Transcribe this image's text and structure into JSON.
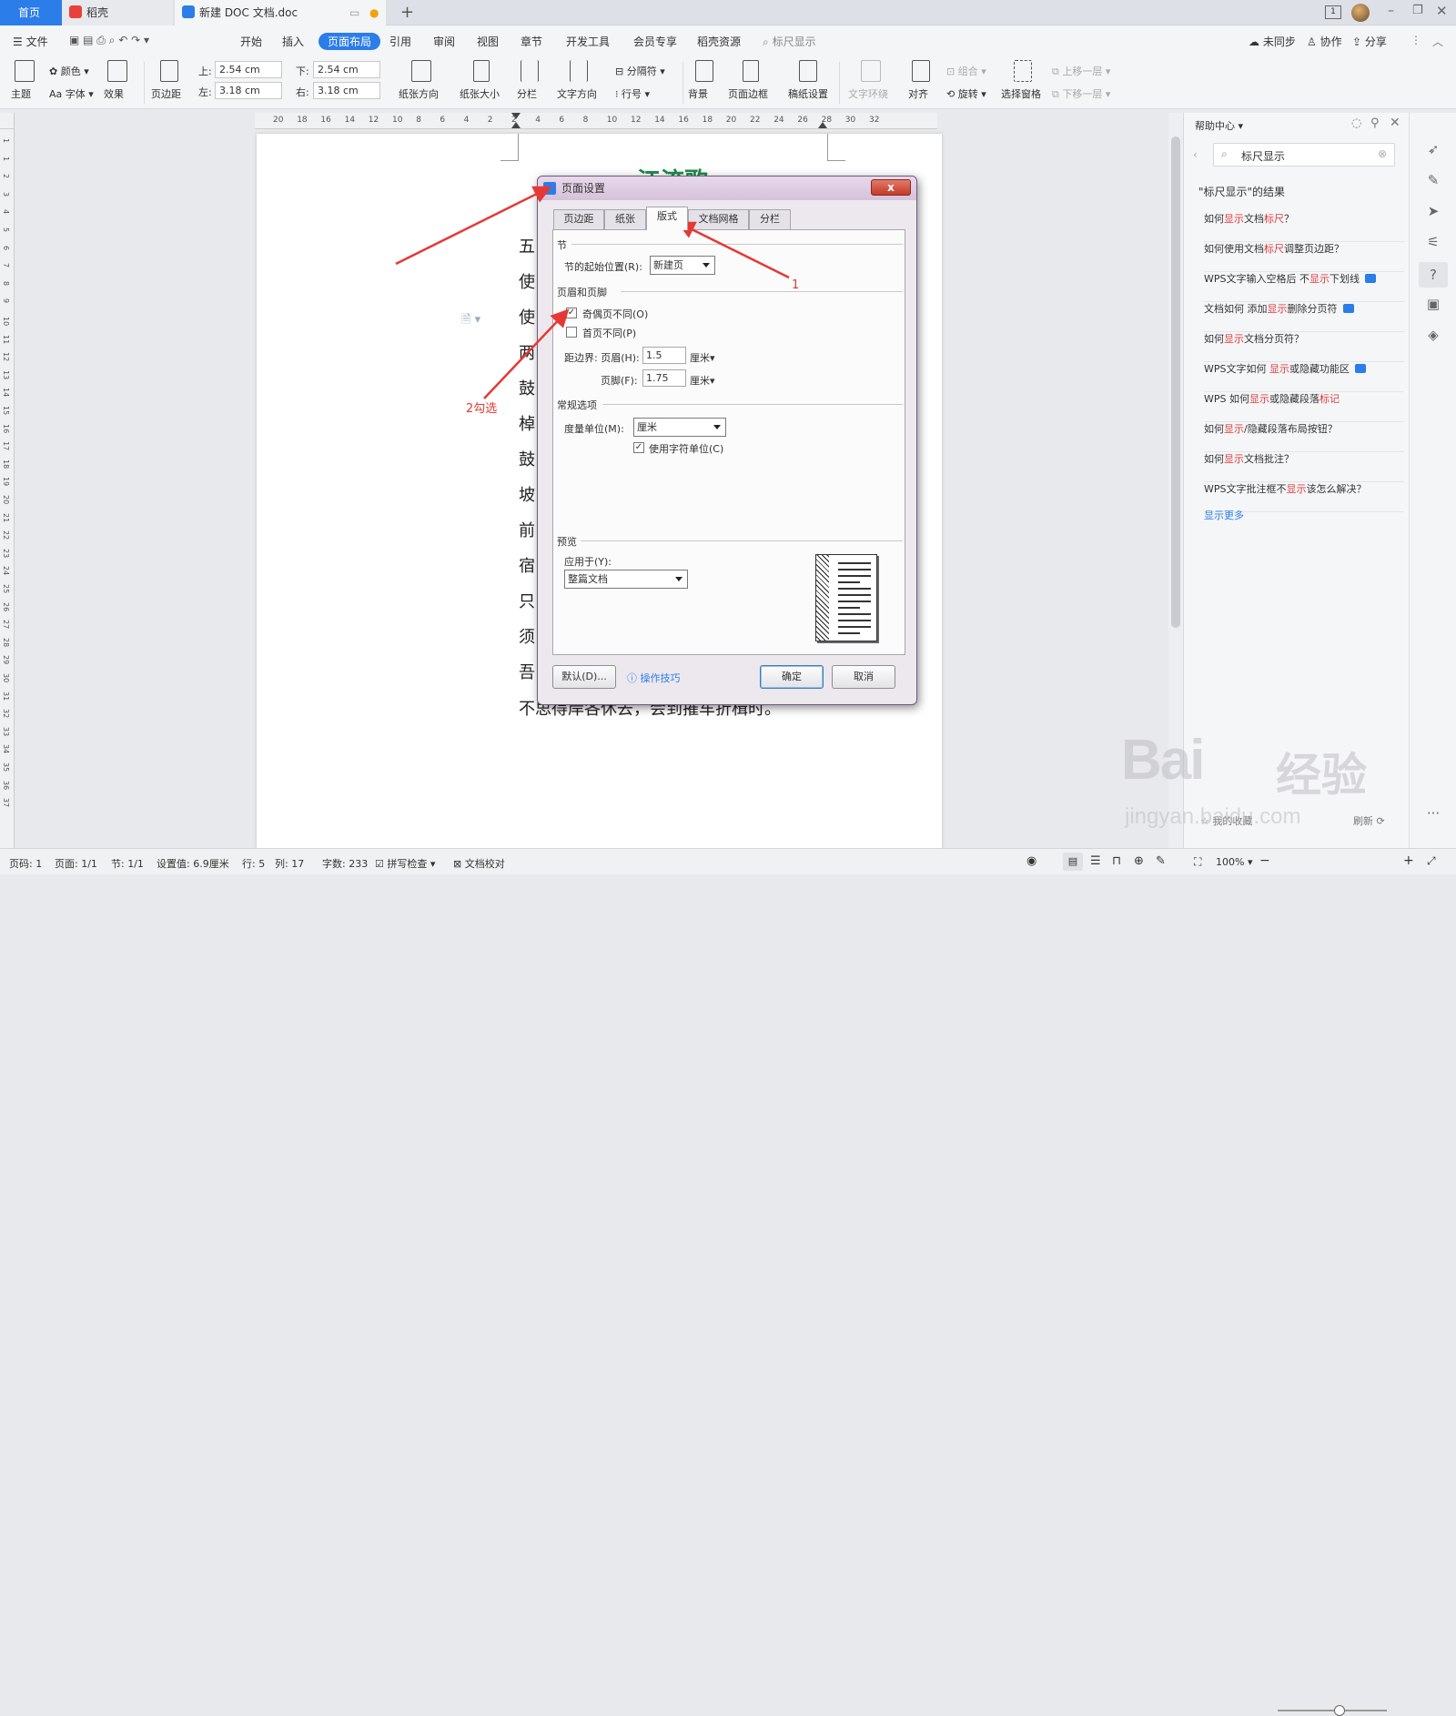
{
  "tabs": [
    {
      "label": "首页",
      "active": true
    },
    {
      "label": "稻壳"
    },
    {
      "label": "新建 DOC 文档.doc"
    }
  ],
  "menu": {
    "file": "文件",
    "items": [
      "开始",
      "插入",
      "页面布局",
      "引用",
      "审阅",
      "视图",
      "章节",
      "开发工具",
      "会员专享",
      "稻壳资源"
    ],
    "active_item": "页面布局",
    "search": "标尺显示",
    "sync": "未同步",
    "collab": "协作",
    "share": "分享"
  },
  "ribbon": {
    "theme": "主题",
    "color": "颜色",
    "font": "字体",
    "effect": "效果",
    "margins": "页边距",
    "top_label": "上:",
    "top_value": "2.54 cm",
    "bottom_label": "下:",
    "bottom_value": "2.54 cm",
    "left_label": "左:",
    "left_value": "3.18 cm",
    "right_label": "右:",
    "right_value": "3.18 cm",
    "orientation": "纸张方向",
    "size": "纸张大小",
    "columns": "分栏",
    "text_dir": "文字方向",
    "breaks": "分隔符",
    "line_num": "行号",
    "background": "背景",
    "border": "页面边框",
    "manuscript": "稿纸设置",
    "wrap": "文字环绕",
    "align": "对齐",
    "group": "组合",
    "rotate": "旋转",
    "select_pane": "选择窗格",
    "bring_fwd": "上移一层",
    "send_back": "下移一层"
  },
  "ruler": {
    "h_ticks": [
      "20",
      "18",
      "16",
      "14",
      "12",
      "10",
      "8",
      "6",
      "4",
      "2",
      "2",
      "4",
      "6",
      "8",
      "10",
      "12",
      "14",
      "16",
      "18",
      "20",
      "22",
      "24",
      "26",
      "28",
      "30",
      "32"
    ],
    "v_ticks": [
      "1",
      "1",
      "2",
      "3",
      "4",
      "5",
      "6",
      "7",
      "8",
      "9",
      "10",
      "11",
      "12",
      "13",
      "14",
      "15",
      "16",
      "17",
      "18",
      "19",
      "20",
      "21",
      "22",
      "23",
      "24",
      "25",
      "26",
      "27",
      "28",
      "29",
      "30",
      "31",
      "32",
      "33",
      "34",
      "35",
      "36",
      "37"
    ]
  },
  "document": {
    "title": "江流歌",
    "line_starts": [
      "五",
      "使",
      "使",
      "两",
      "鼓",
      "棹",
      "鼓",
      "坡",
      "前",
      "宿",
      "只",
      "须",
      "吾"
    ],
    "last_line": "不思得岸各休去，会到摧车折楫时。"
  },
  "dialog": {
    "title": "页面设置",
    "close": "x",
    "tabs": [
      "页边距",
      "纸张",
      "版式",
      "文档网格",
      "分栏"
    ],
    "active_tab": "版式",
    "section_group": "节",
    "section_start_label": "节的起始位置(R):",
    "section_start_value": "新建页",
    "hf_group": "页眉和页脚",
    "odd_even": "奇偶页不同(O)",
    "odd_even_checked": true,
    "first_page": "首页不同(P)",
    "first_page_checked": false,
    "distance_label": "距边界: 页眉(H):",
    "header_value": "1.5",
    "footer_label": "页脚(F):",
    "footer_value": "1.75",
    "unit": "厘米",
    "general_group": "常规选项",
    "measure_label": "度量单位(M):",
    "measure_value": "厘米",
    "char_unit": "使用字符单位(C)",
    "char_unit_checked": true,
    "preview_group": "预览",
    "apply_label": "应用于(Y):",
    "apply_value": "整篇文档",
    "default_btn": "默认(D)...",
    "tips": "操作技巧",
    "ok": "确定",
    "cancel": "取消"
  },
  "annotations": {
    "a1": "1",
    "a2": "2勾选"
  },
  "help": {
    "title": "帮助中心",
    "search_value": "标尺显示",
    "results_title": "\"标尺显示\"的结果",
    "items": [
      {
        "pre": "如何",
        "hl": "显示",
        "post": "文档",
        "hl2": "标尺",
        "post2": "？",
        "video": false
      },
      {
        "pre": "如何使用文档",
        "hl": "标尺",
        "post": "调整页边距？",
        "hl2": "",
        "post2": "",
        "video": false
      },
      {
        "pre": "WPS文字输入空格后 不",
        "hl": "显示",
        "post": "下划线",
        "hl2": "",
        "post2": "",
        "video": true
      },
      {
        "pre": "文档如何 添加",
        "hl": "显示",
        "post": "删除分页符",
        "hl2": "",
        "post2": "",
        "video": true
      },
      {
        "pre": "如何",
        "hl": "显示",
        "post": "文档分页符？",
        "hl2": "",
        "post2": "",
        "video": false
      },
      {
        "pre": "WPS文字如何 ",
        "hl": "显示",
        "post": "或隐藏功能区",
        "hl2": "",
        "post2": "",
        "video": true
      },
      {
        "pre": "WPS 如何",
        "hl": "显示",
        "post": "或隐藏段落",
        "hl2": "标记",
        "post2": "",
        "video": false
      },
      {
        "pre": "如何",
        "hl": "显示",
        "post": "/隐藏段落布局按钮？",
        "hl2": "",
        "post2": "",
        "video": false
      },
      {
        "pre": "如何",
        "hl": "显示",
        "post": "文档批注？",
        "hl2": "",
        "post2": "",
        "video": false
      },
      {
        "pre": "WPS文字批注框不",
        "hl": "显示",
        "post": "该怎么解决？",
        "hl2": "",
        "post2": "",
        "video": false
      }
    ],
    "more": "显示更多",
    "favorites": "我的收藏",
    "refresh": "刷新"
  },
  "status": {
    "page_num": "页码: 1",
    "pages": "页面: 1/1",
    "section": "节: 1/1",
    "setting": "设置值: 6.9厘米",
    "row": "行: 5",
    "col": "列: 17",
    "words": "字数: 233",
    "spell": "拼写检查",
    "proof": "文档校对",
    "zoom": "100%"
  },
  "watermark": {
    "brand": "Bai",
    "cn": "经验",
    "url": "jingyan.baidu.com"
  },
  "colors": {
    "accent": "#2b7de9",
    "highlight": "#e03a3a",
    "annotation": "#e53935"
  }
}
